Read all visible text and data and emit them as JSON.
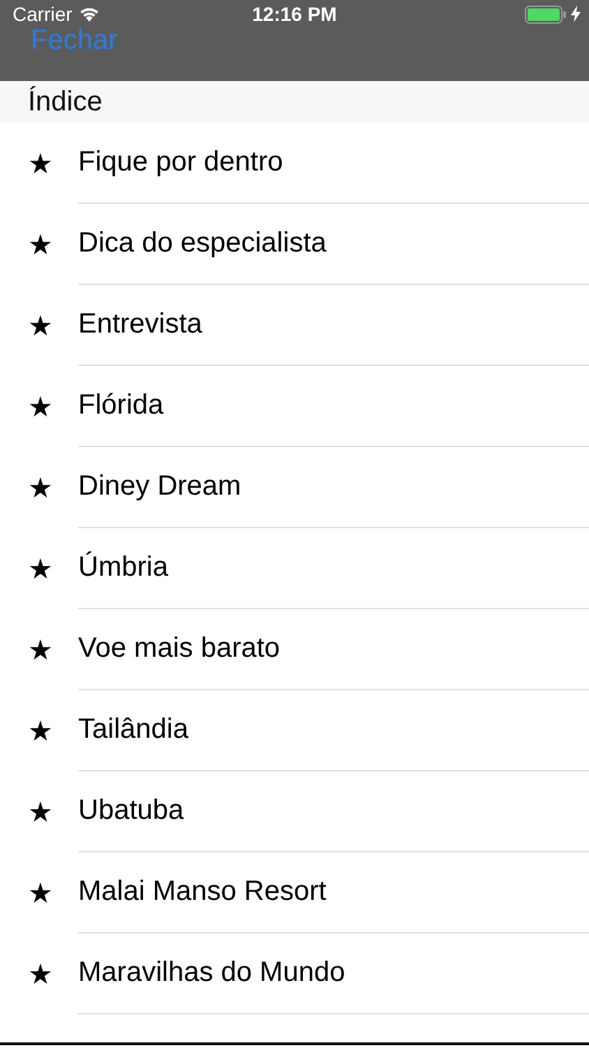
{
  "status_bar": {
    "carrier": "Carrier",
    "time": "12:16 PM"
  },
  "nav_bar": {
    "close_button": "Fechar"
  },
  "section": {
    "title": "Índice"
  },
  "items": [
    {
      "icon": "★",
      "label": "Fique por dentro"
    },
    {
      "icon": "★",
      "label": "Dica do especialista"
    },
    {
      "icon": "★",
      "label": "Entrevista"
    },
    {
      "icon": "★",
      "label": "Flórida"
    },
    {
      "icon": "★",
      "label": "Diney Dream"
    },
    {
      "icon": "★",
      "label": "Úmbria"
    },
    {
      "icon": "★",
      "label": "Voe mais barato"
    },
    {
      "icon": "★",
      "label": "Tailândia"
    },
    {
      "icon": "★",
      "label": "Ubatuba"
    },
    {
      "icon": "★",
      "label": "Malai Manso Resort"
    },
    {
      "icon": "★",
      "label": "Maravilhas do Mundo"
    }
  ]
}
